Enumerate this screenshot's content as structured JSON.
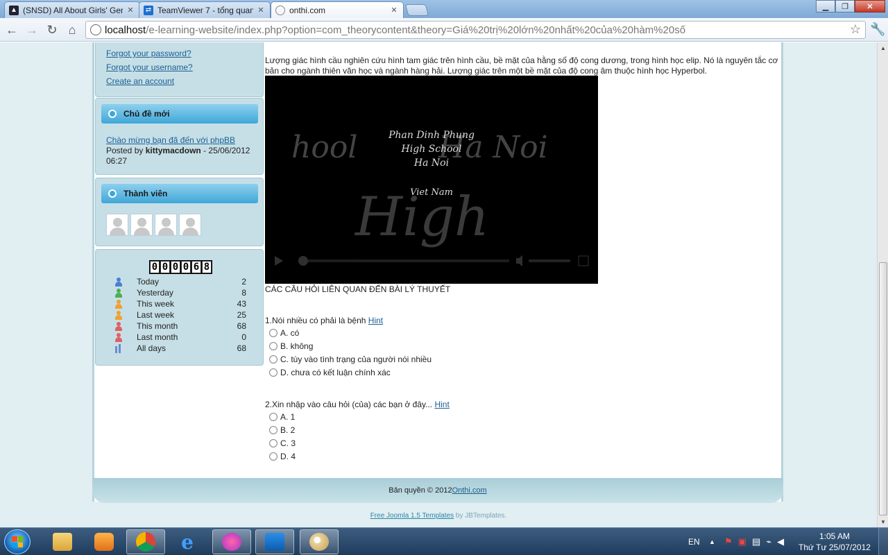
{
  "browser": {
    "tabs": [
      {
        "title": "(SNSD) All About Girls' Ger",
        "icon": "snsd-favicon-icon",
        "active": false
      },
      {
        "title": "TeamViewer 7 - tổng quan",
        "icon": "teamviewer-favicon-icon",
        "active": false
      },
      {
        "title": "onthi.com",
        "icon": "globe-favicon-icon",
        "active": true
      }
    ],
    "url_host": "localhost",
    "url_path": "/e-learning-website/index.php?option=com_theorycontent&theory=Giá%20trị%20lớn%20nhất%20của%20hàm%20số"
  },
  "sidebar": {
    "login_links": {
      "forgot_password": "Forgot your password?",
      "forgot_username": "Forgot your username?",
      "create_account": "Create an account"
    },
    "new_topics": {
      "title": "Chủ đề mới",
      "post_title": "Chào mừng bạn đã đến với phpBB",
      "posted_by_label": "Posted by",
      "author": "kittymacdown",
      "date_part": " - 25/06/2012",
      "time": "06:27"
    },
    "members": {
      "title": "Thành viên",
      "count_avatars": 4
    },
    "visitors": {
      "counter_digits": [
        "0",
        "0",
        "0",
        "0",
        "6",
        "8"
      ],
      "rows": [
        {
          "label": "Today",
          "value": "2",
          "color": "#4a7fd0"
        },
        {
          "label": "Yesterday",
          "value": "8",
          "color": "#4caf50"
        },
        {
          "label": "This week",
          "value": "43",
          "color": "#f0a030"
        },
        {
          "label": "Last week",
          "value": "25",
          "color": "#f0a030"
        },
        {
          "label": "This month",
          "value": "68",
          "color": "#e06060"
        },
        {
          "label": "Last month",
          "value": "0",
          "color": "#e06060"
        },
        {
          "label": "All days",
          "value": "68",
          "color": "#6a8ad0"
        }
      ]
    }
  },
  "content": {
    "paragraph": "Lượng giác hình cầu nghiên cứu hình tam giác trên hình cầu, bề mặt của hằng số độ cong dương, trong hình học elip. Nó là nguyên tắc cơ bản cho ngành thiên văn học và ngành hàng hải. Lượng giác trên một bề mặt của độ cong âm thuộc hình học Hyperbol.",
    "video": {
      "line1": "Phan Dinh Phung",
      "line2": "High School",
      "line3": "Ha Noi",
      "line4": "Viet Nam",
      "bg_left": "hool",
      "bg_right": "Ha Noi",
      "bg_bottom": "High"
    },
    "section_heading": "CÁC CÂU HỎI LIÊN QUAN ĐẾN BÀI LÝ THUYẾT",
    "hint_label": "Hint",
    "questions": [
      {
        "text": "1.Nói nhiều có phải là bệnh ",
        "options": [
          "A. có",
          "B. không",
          "C. tùy vào tình trạng của người nói nhiều",
          "D. chưa có kết luận chính xác"
        ]
      },
      {
        "text": "2.Xin nhập vào câu hỏi (của) các bạn ở đây... ",
        "options": [
          "A. 1",
          "B. 2",
          "C. 3",
          "D. 4"
        ]
      }
    ]
  },
  "footer": {
    "copyright": "Bản quyền © 2012 ",
    "site_link": "Onthi.com",
    "credits_link": "Free Joomla 1.5 Templates",
    "credits_by": " by JBTemplates."
  },
  "taskbar": {
    "language": "EN",
    "time": "1:05 AM",
    "date": "Thứ Tư 25/07/2012"
  }
}
